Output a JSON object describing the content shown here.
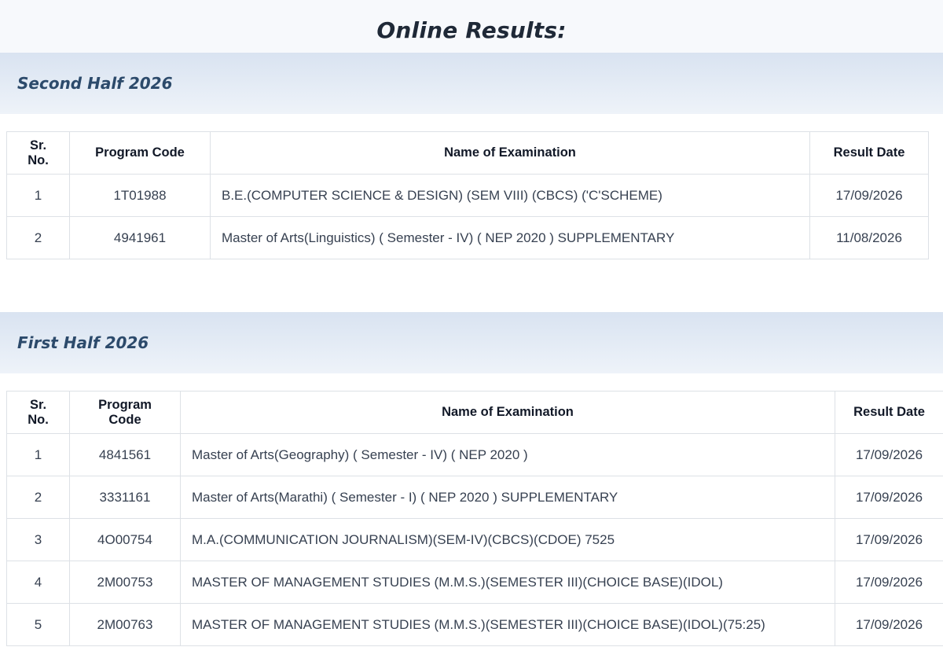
{
  "page": {
    "title": "Online Results:"
  },
  "columns": {
    "sr_no": "Sr. No.",
    "program_code": "Program Code",
    "exam_name": "Name of Examination",
    "result_date": "Result Date"
  },
  "sections": [
    {
      "title": "Second Half 2026",
      "rows": [
        {
          "sr": "1",
          "code": "1T01988",
          "name": "B.E.(COMPUTER SCIENCE & DESIGN) (SEM VIII) (CBCS) ('C'SCHEME)",
          "date": "17/09/2026"
        },
        {
          "sr": "2",
          "code": "4941961",
          "name": "Master of Arts(Linguistics) ( Semester - IV) ( NEP 2020 ) SUPPLEMENTARY",
          "date": "11/08/2026"
        }
      ]
    },
    {
      "title": "First Half 2026",
      "rows": [
        {
          "sr": "1",
          "code": "4841561",
          "name": "Master of Arts(Geography) ( Semester - IV) ( NEP 2020 )",
          "date": "17/09/2026"
        },
        {
          "sr": "2",
          "code": "3331161",
          "name": "Master of Arts(Marathi) ( Semester - I) ( NEP 2020 ) SUPPLEMENTARY",
          "date": "17/09/2026"
        },
        {
          "sr": "3",
          "code": "4O00754",
          "name": "M.A.(COMMUNICATION JOURNALISM)(SEM-IV)(CBCS)(CDOE) 7525",
          "date": "17/09/2026"
        },
        {
          "sr": "4",
          "code": "2M00753",
          "name": "MASTER OF MANAGEMENT STUDIES (M.M.S.)(SEMESTER III)(CHOICE BASE)(IDOL)",
          "date": "17/09/2026"
        },
        {
          "sr": "5",
          "code": "2M00763",
          "name": "MASTER OF MANAGEMENT STUDIES (M.M.S.)(SEMESTER III)(CHOICE BASE)(IDOL)(75:25)",
          "date": "17/09/2026"
        }
      ]
    }
  ]
}
